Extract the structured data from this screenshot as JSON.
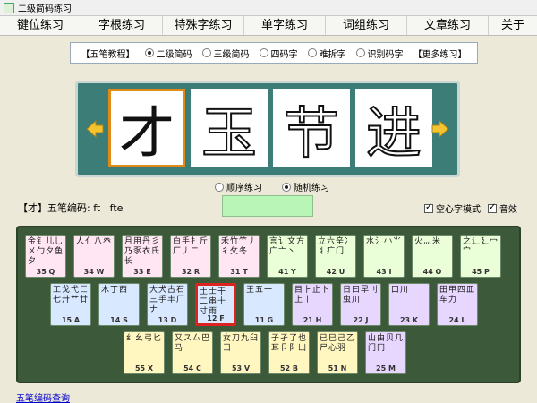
{
  "window": {
    "title": "二级简码练习"
  },
  "menu": [
    "键位练习",
    "字根练习",
    "特殊字练习",
    "单字练习",
    "词组练习",
    "文章练习",
    "关于"
  ],
  "mode_bar": {
    "tutorial": "【五笔教程】",
    "options": [
      "二级简码",
      "三级简码",
      "四码字",
      "难拆字",
      "识别码字"
    ],
    "selected": 0,
    "more": "【更多练习】"
  },
  "display": {
    "chars": [
      "才",
      "玉",
      "节",
      "进"
    ],
    "current_index": 0
  },
  "order": {
    "options": [
      "顺序练习",
      "随机练习"
    ],
    "selected": 1
  },
  "code_info": {
    "text": "【才】五笔编码: ft   fte"
  },
  "answer_input": {
    "value": ""
  },
  "checkboxes": {
    "hollow": "空心字模式",
    "sound": "音效"
  },
  "keyboard": {
    "rows": [
      [
        {
          "roots": "金钅儿乚ㄨ勹夕鱼夕",
          "code": "35 Q"
        },
        {
          "roots": "人亻八癶",
          "code": "34 W"
        },
        {
          "roots": "月用丹彡乃豕衣氏长",
          "code": "33 E"
        },
        {
          "roots": "白手扌斤厂丿二",
          "code": "32 R"
        },
        {
          "roots": "禾竹⺮丿彳攵冬",
          "code": "31 T"
        },
        {
          "roots": "言讠文方广亠丶",
          "code": "41 Y"
        },
        {
          "roots": "立六辛冫丬疒门",
          "code": "42 U"
        },
        {
          "roots": "水氵小⺌",
          "code": "43 I"
        },
        {
          "roots": "火灬米",
          "code": "44 O"
        },
        {
          "roots": "之辶廴冖宀",
          "code": "45 P"
        }
      ],
      [
        {
          "roots": "工戈弋匚七廾艹廿",
          "code": "15 A"
        },
        {
          "roots": "木丁西",
          "code": "14 S"
        },
        {
          "roots": "大犬古石三手丰厂ナ",
          "code": "13 D"
        },
        {
          "roots": "土士干二串十寸雨",
          "code": "12 F"
        },
        {
          "roots": "王五一",
          "code": "11 G"
        },
        {
          "roots": "目⺊止卜上丨",
          "code": "21 H"
        },
        {
          "roots": "日曰早刂虫川",
          "code": "22 J"
        },
        {
          "roots": "口川",
          "code": "23 K"
        },
        {
          "roots": "田甲四皿车力",
          "code": "24 L"
        }
      ],
      [
        {
          "roots": "纟幺弓匕",
          "code": "55 X"
        },
        {
          "roots": "又ス厶巴马",
          "code": "54 C"
        },
        {
          "roots": "女刀九臼彐",
          "code": "53 V"
        },
        {
          "roots": "子孑了也耳卩阝凵",
          "code": "52 B"
        },
        {
          "roots": "已巳己乙尸心羽",
          "code": "51 N"
        },
        {
          "roots": "山由贝几门冂",
          "code": "25 M"
        }
      ]
    ],
    "active_code": "12 F",
    "colors": {
      "key_1": "#d8e8ff",
      "key_2": "#e7d7ff",
      "key_3": "#ffe6f2",
      "key_4": "#eaffd7",
      "key_5": "#fff6c0",
      "accent": "#d22"
    }
  },
  "bottom_link": "五笔编码查询"
}
